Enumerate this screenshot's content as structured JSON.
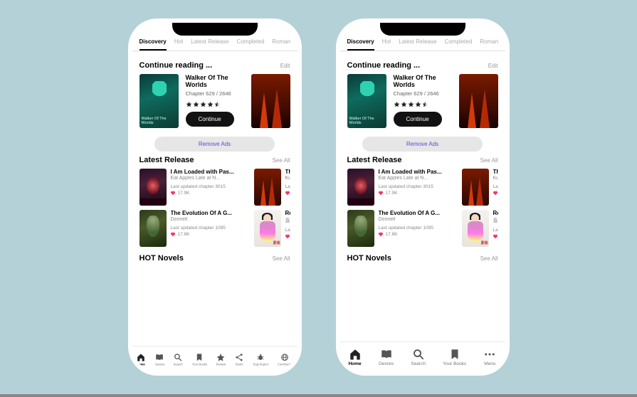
{
  "tabs": [
    "Discovery",
    "Hot",
    "Latest Release",
    "Completed",
    "Roman"
  ],
  "active_tab": 0,
  "continue": {
    "heading": "Continue reading ...",
    "edit": "Edit",
    "book": {
      "title": "Walker Of The Worlds",
      "chapter": "Chapter 629 / 2646",
      "rating": 4.5,
      "button": "Continue"
    }
  },
  "remove_ads": "Remove Ads",
  "latest": {
    "heading": "Latest Release",
    "see_all": "See All",
    "items": [
      {
        "title": "I Am Loaded with Pas...",
        "author": "Eat Apples Late at N...",
        "meta": "Last updated chapter 3015",
        "likes": "17.9K"
      },
      {
        "title": "Th",
        "author": "Ku",
        "meta": "La",
        "likes": ""
      },
      {
        "title": "The Evolution Of A G...",
        "author": "Donnell",
        "meta": "Last updated chapter 1095",
        "likes": "17.8K"
      },
      {
        "title": "Re",
        "author": "直",
        "meta": "La",
        "likes": ""
      }
    ]
  },
  "hot": {
    "heading": "HOT Novels",
    "see_all": "See All"
  },
  "nav_small": [
    {
      "label": "Home",
      "icon": "home"
    },
    {
      "label": "Genres",
      "icon": "book-open"
    },
    {
      "label": "Search",
      "icon": "search"
    },
    {
      "label": "Your Books",
      "icon": "bookmark"
    },
    {
      "label": "Review",
      "icon": "star"
    },
    {
      "label": "Share",
      "icon": "share"
    },
    {
      "label": "Bug Reprot",
      "icon": "bug"
    },
    {
      "label": "Community",
      "icon": "globe"
    }
  ],
  "nav_large": [
    {
      "label": "Home",
      "icon": "home"
    },
    {
      "label": "Genres",
      "icon": "book-open"
    },
    {
      "label": "Search",
      "icon": "search"
    },
    {
      "label": "Your Books",
      "icon": "bookmark"
    },
    {
      "label": "Menu",
      "icon": "dots"
    }
  ]
}
